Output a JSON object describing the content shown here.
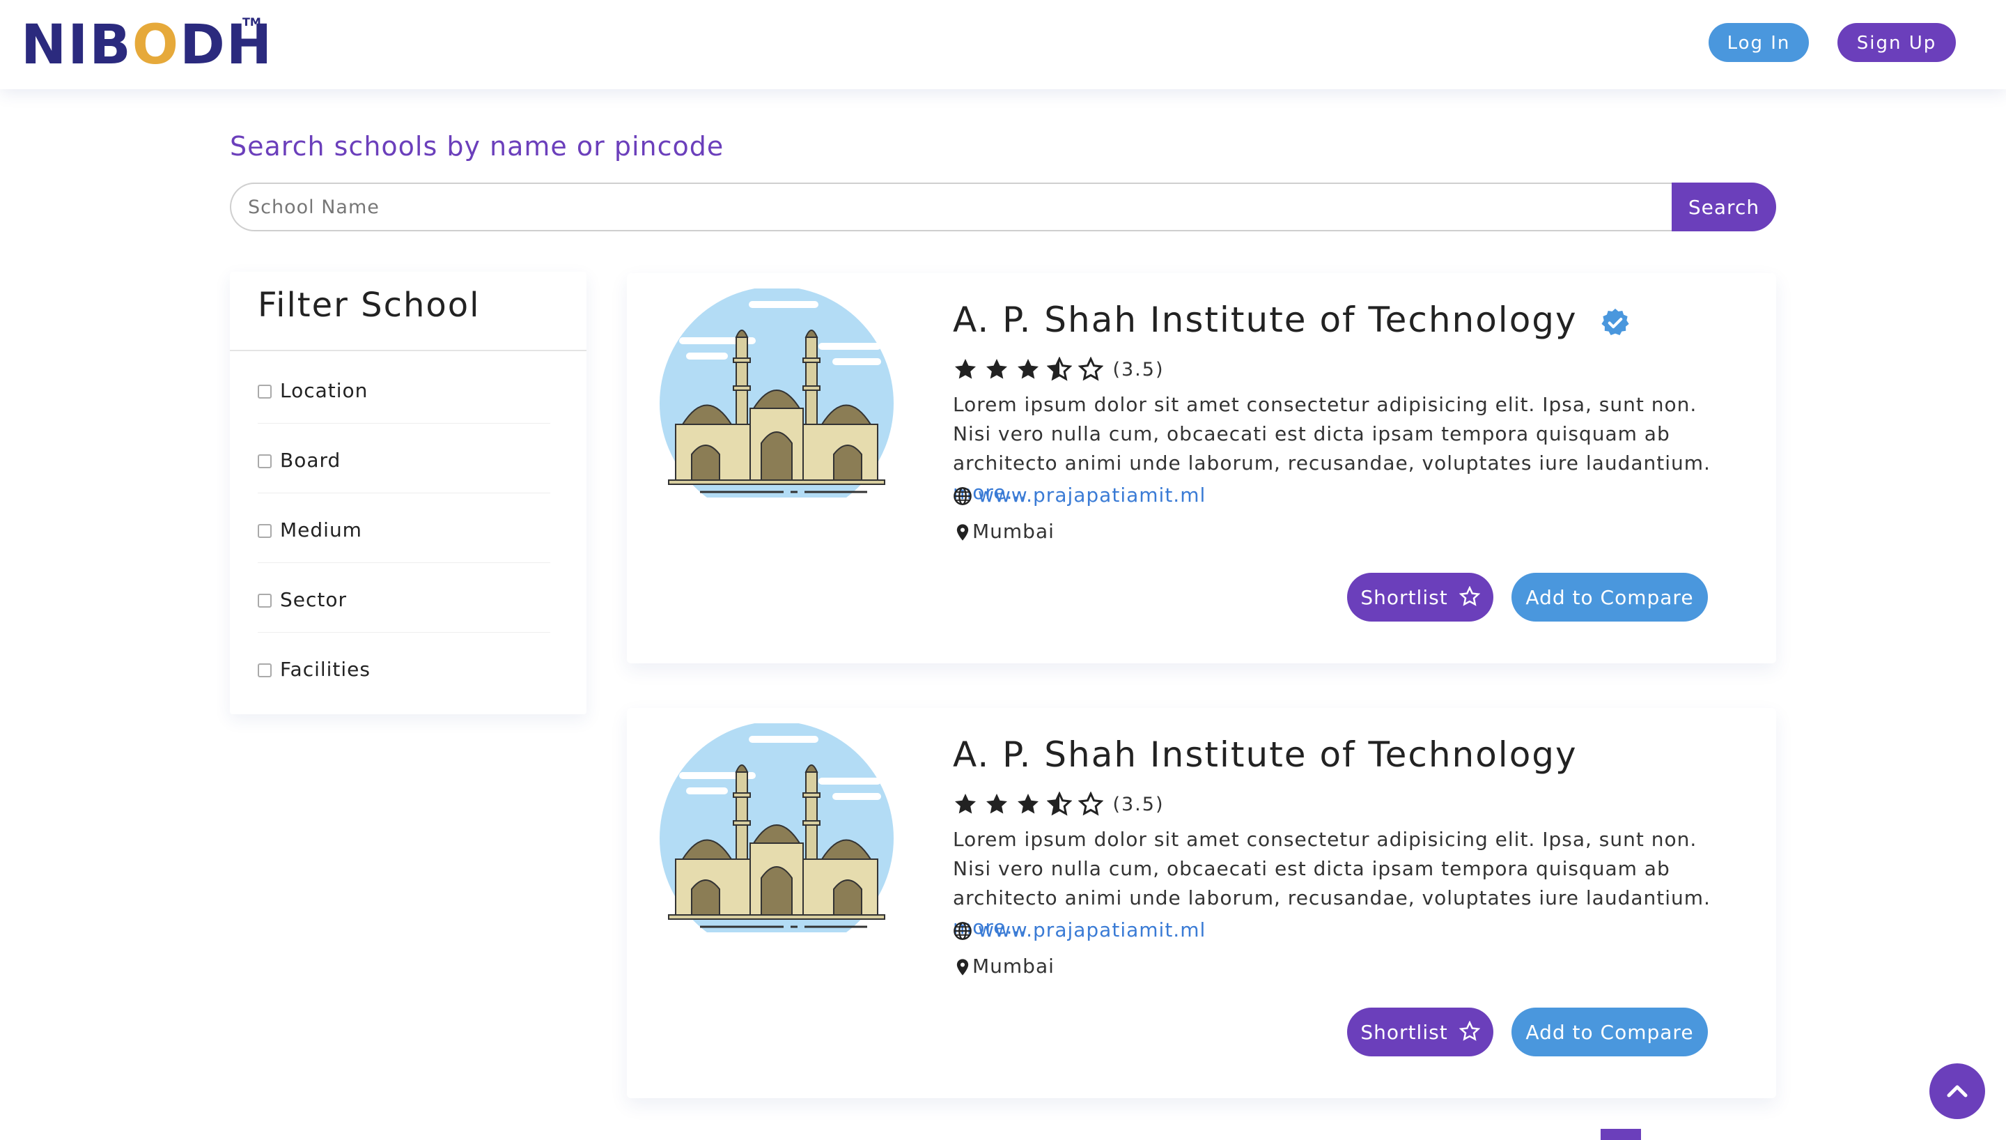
{
  "brand": {
    "logo_text": "NIBODH",
    "trademark": "TM",
    "colors": {
      "primary": "#6b3fbb",
      "secondary": "#4a97dd",
      "logo": "#2b2a7e",
      "logo_accent": "#e6a93a"
    }
  },
  "nav": {
    "login_label": "Log In",
    "signup_label": "Sign Up"
  },
  "search": {
    "title": "Search schools by name or pincode",
    "placeholder": "School Name",
    "value": "",
    "button_label": "Search"
  },
  "filters": {
    "title": "Filter School",
    "items": [
      {
        "label": "Location",
        "checked": false
      },
      {
        "label": "Board",
        "checked": false
      },
      {
        "label": "Medium",
        "checked": false
      },
      {
        "label": "Sector",
        "checked": false
      },
      {
        "label": "Facilities",
        "checked": false
      }
    ]
  },
  "schools": [
    {
      "name": "A. P. Shah Institute of Technology",
      "verified": true,
      "rating": 3.5,
      "rating_text": "(3.5)",
      "description": "Lorem ipsum dolor sit amet consectetur adipisicing elit. Ipsa, sunt non. Nisi vero nulla cum, obcaecati est dicta ipsam tempora quisquam ab architecto animi unde laborum, recusandae, voluptates iure laudantium.",
      "more_label": "more...",
      "website": "www.prajapatiamit.ml",
      "location": "Mumbai",
      "shortlist_label": "Shortlist",
      "compare_label": "Add to Compare"
    },
    {
      "name": "A. P. Shah Institute of Technology",
      "verified": false,
      "rating": 3.5,
      "rating_text": "(3.5)",
      "description": "Lorem ipsum dolor sit amet consectetur adipisicing elit. Ipsa, sunt non. Nisi vero nulla cum, obcaecati est dicta ipsam tempora quisquam ab architecto animi unde laborum, recusandae, voluptates iure laudantium.",
      "more_label": "more...",
      "website": "www.prajapatiamit.ml",
      "location": "Mumbai",
      "shortlist_label": "Shortlist",
      "compare_label": "Add to Compare"
    }
  ],
  "icons": {
    "verified": "verified-badge-icon",
    "star_full": "star-full-icon",
    "star_half": "star-half-icon",
    "star_empty": "star-empty-icon",
    "globe": "globe-icon",
    "map_pin": "map-pin-icon",
    "shortlist": "star-outline-icon",
    "scroll_top": "chevron-up-icon"
  }
}
